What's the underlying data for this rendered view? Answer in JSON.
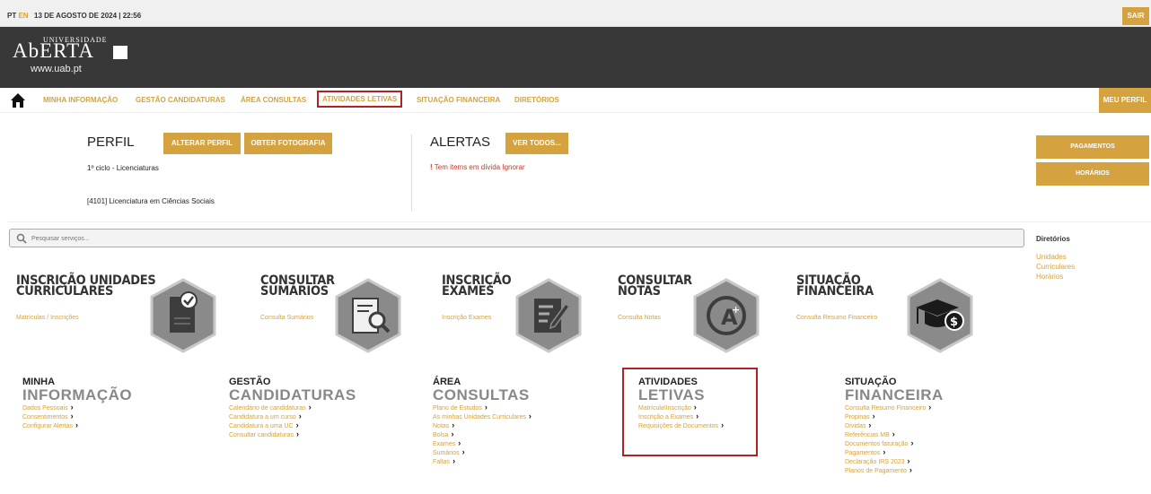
{
  "topbar": {
    "lang_pt": "PT",
    "lang_en": "EN",
    "date": "13 DE AGOSTO DE 2024 | 22:56",
    "logout": "SAIR"
  },
  "logo": {
    "university": "UNIVERSIDADE",
    "name": "AbERTA",
    "url": "www.uab.pt"
  },
  "nav": {
    "items": [
      {
        "label": "MINHA INFORMAÇÃO"
      },
      {
        "label": "GESTÃO CANDIDATURAS"
      },
      {
        "label": "ÁREA CONSULTAS"
      },
      {
        "label": "ATIVIDADES LETIVAS"
      },
      {
        "label": "SITUAÇÃO FINANCEIRA"
      },
      {
        "label": "DIRETÓRIOS"
      }
    ],
    "profile_button": "MEU PERFIL"
  },
  "perfil": {
    "title": "PERFIL",
    "change_button": "ALTERAR PERFIL",
    "photo_button": "OBTER FOTOGRAFIA",
    "cycle": "1º ciclo - Licenciaturas",
    "course": "[4101] Licenciatura em Ciências Sociais"
  },
  "alertas": {
    "title": "ALERTAS",
    "see_all_button": "VER TODOS...",
    "mark": "!",
    "message": "Tem items em dívida",
    "ignore": "Ignorar"
  },
  "right_buttons": {
    "payments": "PAGAMENTOS",
    "schedules": "HORÁRIOS"
  },
  "search": {
    "placeholder": "Pesquisar serviços..."
  },
  "diretorios": {
    "title": "Diretórios",
    "links": [
      "Unidades",
      "Curriculares",
      "Horários"
    ]
  },
  "tiles": [
    {
      "title1": "INSCRIÇÃO UNIDADES",
      "title2": "CURRICULARES",
      "link": "Matrículas / Inscrições",
      "icon": "document-check-icon"
    },
    {
      "title1": "CONSULTAR",
      "title2": "SUMÁRIOS",
      "link": "Consulta Sumários",
      "icon": "document-search-icon"
    },
    {
      "title1": "INSCRIÇÃO",
      "title2": "EXAMES",
      "link": "Inscrição Exames",
      "icon": "exam-edit-icon"
    },
    {
      "title1": "CONSULTAR",
      "title2": "NOTAS",
      "link": "Consulta Notas",
      "icon": "grade-icon"
    },
    {
      "title1": "SITUAÇÃO",
      "title2": "FINANCEIRA",
      "link": "Consulta Resumo Financeiro",
      "icon": "graduation-money-icon"
    }
  ],
  "menus": [
    {
      "small": "MINHA",
      "big": "INFORMAÇÃO",
      "links": [
        "Dados Pessoais",
        "Consentimentos",
        "Configurar Alertas"
      ]
    },
    {
      "small": "GESTÃO",
      "big": "CANDIDATURAS",
      "links": [
        "Calendário de candidaturas",
        "Candidatura a um curso",
        "Candidatura a uma UC",
        "Consultar candidaturas"
      ]
    },
    {
      "small": "ÁREA",
      "big": "CONSULTAS",
      "links": [
        "Plano de Estudos",
        "As minhas Unidades Curriculares",
        "Notas",
        "Bolsa",
        "Exames",
        "Sumários",
        "Faltas"
      ]
    },
    {
      "small": "ATIVIDADES",
      "big": "LETIVAS",
      "links": [
        "Matrícula\\Inscrição",
        "Inscrição a Exames",
        "Requisições de Documentos"
      ]
    },
    {
      "small": "SITUAÇÃO",
      "big": "FINANCEIRA",
      "links": [
        "Consulta Resumo Financeiro",
        "Propinas",
        "Dívidas",
        "Referências MB",
        "Documentos faturação",
        "Pagamentos",
        "Declaração IRS 2023",
        "Planos de Pagamento"
      ]
    }
  ],
  "colors": {
    "accent": "#d4a23e",
    "header": "#383838",
    "highlight": "#b22222",
    "icon_hex": "#8a8a8a"
  }
}
